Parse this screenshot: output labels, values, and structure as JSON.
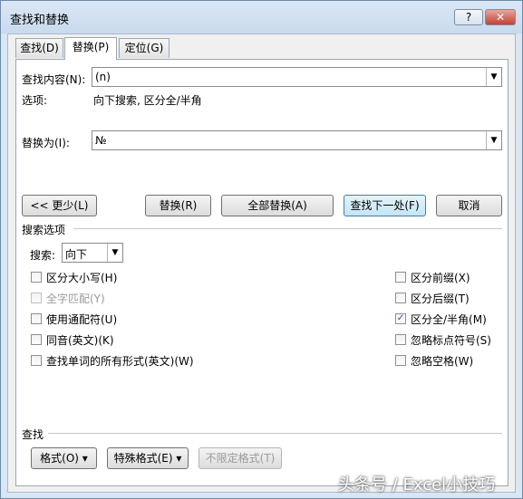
{
  "window": {
    "title": "查找和替换",
    "help_label": "?",
    "close_label": "✕"
  },
  "tabs": [
    {
      "label": "查找(D)"
    },
    {
      "label": "替换(P)",
      "active": true
    },
    {
      "label": "定位(G)"
    }
  ],
  "find": {
    "label": "查找内容(N):",
    "value": "(n)"
  },
  "options": {
    "label": "选项:",
    "value": "向下搜索, 区分全/半角"
  },
  "replace": {
    "label": "替换为(I):",
    "value": "№"
  },
  "buttons": {
    "less": "<< 更少(L)",
    "replace": "替换(R)",
    "replace_all": "全部替换(A)",
    "find_next": "查找下一处(F)",
    "cancel": "取消"
  },
  "search_options": {
    "heading": "搜索选项",
    "search_label": "搜索:",
    "search_value": "向下",
    "left": [
      {
        "label": "区分大小写(H)",
        "checked": false,
        "disabled": false
      },
      {
        "label": "全字匹配(Y)",
        "checked": false,
        "disabled": true
      },
      {
        "label": "使用通配符(U)",
        "checked": false,
        "disabled": false
      },
      {
        "label": "同音(英文)(K)",
        "checked": false,
        "disabled": false
      },
      {
        "label": "查找单词的所有形式(英文)(W)",
        "checked": false,
        "disabled": false
      }
    ],
    "right": [
      {
        "label": "区分前缀(X)",
        "checked": false
      },
      {
        "label": "区分后缀(T)",
        "checked": false
      },
      {
        "label": "区分全/半角(M)",
        "checked": true
      },
      {
        "label": "忽略标点符号(S)",
        "checked": false
      },
      {
        "label": "忽略空格(W)",
        "checked": false
      }
    ]
  },
  "find_section": {
    "heading": "查找",
    "format": "格式(O) ▾",
    "special": "特殊格式(E) ▾",
    "no_format": "不限定格式(T)"
  },
  "watermark": "头条号 / Excel小技巧",
  "icons": {
    "dropdown": "chevron-down-icon",
    "check": "checkmark-icon"
  }
}
